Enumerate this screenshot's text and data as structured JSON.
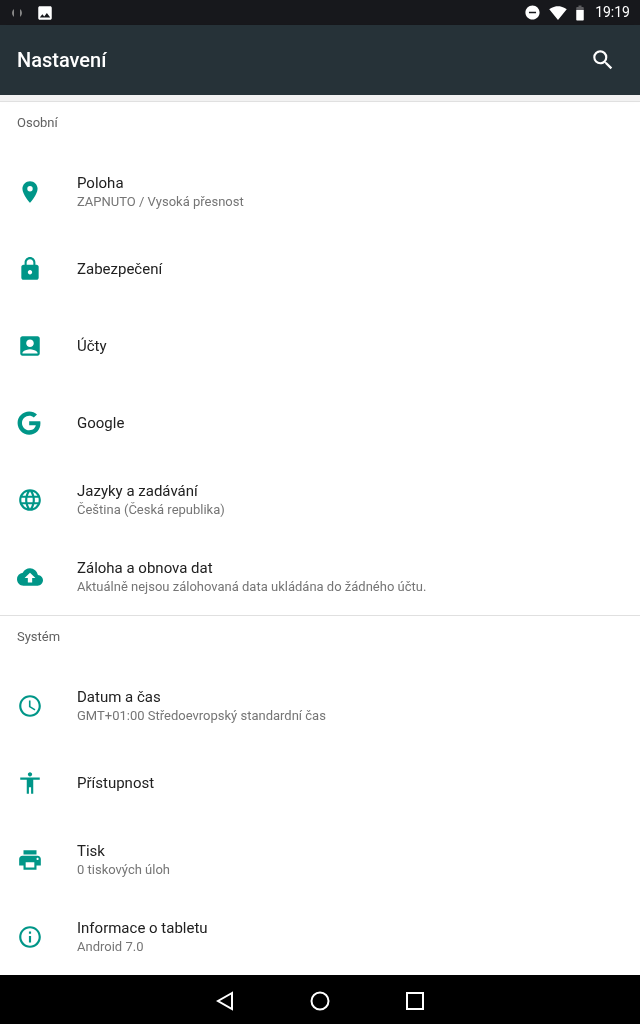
{
  "status_bar": {
    "time": "19:19"
  },
  "app_bar": {
    "title": "Nastavení"
  },
  "sections": [
    {
      "title": "Osobní",
      "items": [
        {
          "title": "Poloha",
          "subtitle": "ZAPNUTO / Vysoká přesnost"
        },
        {
          "title": "Zabezpečení"
        },
        {
          "title": "Účty"
        },
        {
          "title": "Google"
        },
        {
          "title": "Jazyky a zadávání",
          "subtitle": "Čeština (Česká republika)"
        },
        {
          "title": "Záloha a obnova dat",
          "subtitle": "Aktuálně nejsou zálohovaná data ukládána do žádného účtu."
        }
      ]
    },
    {
      "title": "Systém",
      "items": [
        {
          "title": "Datum a čas",
          "subtitle": "GMT+01:00 Středoevropský standardní čas"
        },
        {
          "title": "Přístupnost"
        },
        {
          "title": "Tisk",
          "subtitle": "0 tiskových úloh"
        },
        {
          "title": "Informace o tabletu",
          "subtitle": "Android 7.0"
        }
      ]
    }
  ]
}
